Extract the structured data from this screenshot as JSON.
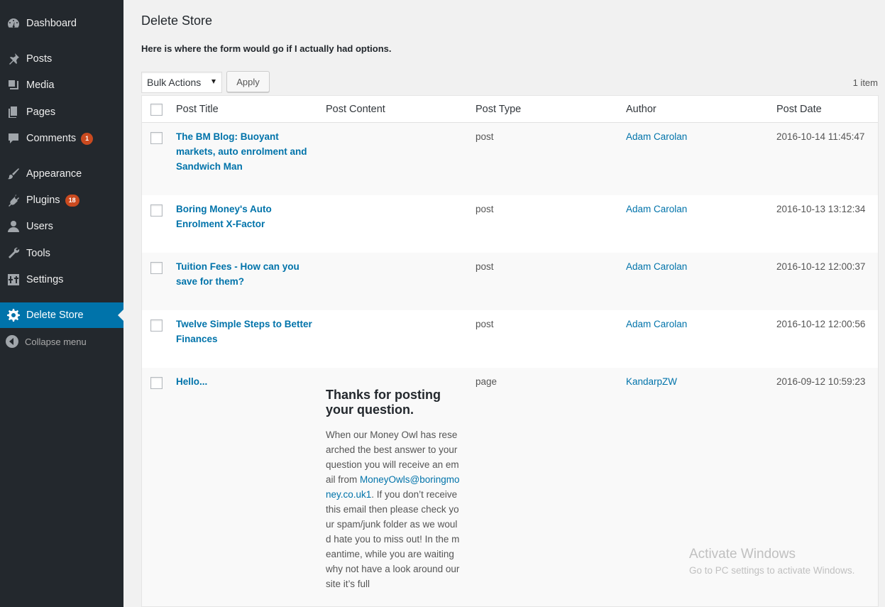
{
  "sidebar": {
    "items": [
      {
        "label": "Dashboard",
        "icon": "dashboard-icon"
      },
      {
        "label": "Posts",
        "icon": "pin-icon"
      },
      {
        "label": "Media",
        "icon": "media-icon"
      },
      {
        "label": "Pages",
        "icon": "pages-icon"
      },
      {
        "label": "Comments",
        "icon": "comment-icon",
        "badge": "1"
      },
      {
        "label": "Appearance",
        "icon": "brush-icon"
      },
      {
        "label": "Plugins",
        "icon": "plug-icon",
        "badge": "18"
      },
      {
        "label": "Users",
        "icon": "user-icon"
      },
      {
        "label": "Tools",
        "icon": "wrench-icon"
      },
      {
        "label": "Settings",
        "icon": "settings-icon"
      },
      {
        "label": "Delete Store",
        "icon": "gear-icon",
        "active": true
      }
    ],
    "collapse_label": "Collapse menu"
  },
  "main": {
    "title": "Delete Store",
    "intro": "Here is where the form would go if I actually had options.",
    "bulk_actions": {
      "selected": "Bulk Actions"
    },
    "apply_label": "Apply",
    "item_count": "1 item"
  },
  "table": {
    "columns": [
      "Post Title",
      "Post Content",
      "Post Type",
      "Author",
      "Post Date"
    ],
    "rows": [
      {
        "title": "The BM Blog: Buoyant markets, auto enrolment and Sandwich Man",
        "type": "post",
        "author": "Adam Carolan",
        "date": "2016-10-14 11:45:47"
      },
      {
        "title": "Boring Money's Auto Enrolment X-Factor",
        "type": "post",
        "author": "Adam Carolan",
        "date": "2016-10-13 13:12:34"
      },
      {
        "title": "Tuition Fees - How can you save for them?",
        "type": "post",
        "author": "Adam Carolan",
        "date": "2016-10-12 12:00:37"
      },
      {
        "title": "Twelve Simple Steps to Better Finances",
        "type": "post",
        "author": "Adam Carolan",
        "date": "2016-10-12 12:00:56"
      },
      {
        "title": "Hello...",
        "type": "page",
        "author": "KandarpZW",
        "date": "2016-09-12 10:59:23",
        "content_heading": "Thanks for posting your question.",
        "content_before_link": "When our Money Owl has researched the best answer to your question you will receive an email from ",
        "content_link": "MoneyOwls@boringmoney.co.uk1",
        "content_after_link": ".  If you don’t receive this email then please check your spam/junk folder as we would hate you to miss out! In the meantime, while you are waiting why not have a look around our site it’s full"
      }
    ]
  },
  "watermark": {
    "line1": "Activate Windows",
    "line2": "Go to PC settings to activate Windows."
  },
  "colors": {
    "sidebar_bg": "#23282d",
    "active_bg": "#0073aa",
    "link": "#0073aa",
    "badge": "#ca4a1f"
  }
}
